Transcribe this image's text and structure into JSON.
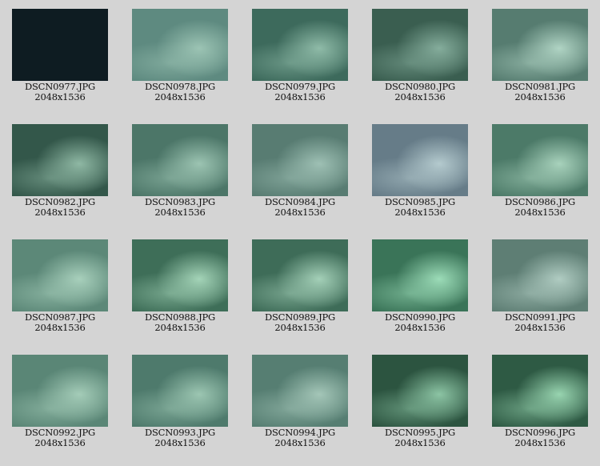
{
  "gallery": {
    "items": [
      {
        "name": "DSCN0977.JPG",
        "dims": "2048x1536",
        "base": "#0e1c22",
        "light": "#12242b"
      },
      {
        "name": "DSCN0978.JPG",
        "dims": "2048x1536",
        "base": "#5e8a80",
        "light": "#9cc4b4"
      },
      {
        "name": "DSCN0979.JPG",
        "dims": "2048x1536",
        "base": "#3d6a5c",
        "light": "#8fbba8"
      },
      {
        "name": "DSCN0980.JPG",
        "dims": "2048x1536",
        "base": "#3a5e50",
        "light": "#85ad9c"
      },
      {
        "name": "DSCN0981.JPG",
        "dims": "2048x1536",
        "base": "#567c70",
        "light": "#b0d4c4"
      },
      {
        "name": "DSCN0982.JPG",
        "dims": "2048x1536",
        "base": "#33574a",
        "light": "#8fb8a4"
      },
      {
        "name": "DSCN0983.JPG",
        "dims": "2048x1536",
        "base": "#4c7668",
        "light": "#9cc4b2"
      },
      {
        "name": "DSCN0984.JPG",
        "dims": "2048x1536",
        "base": "#587c72",
        "light": "#9ec0b4"
      },
      {
        "name": "DSCN0985.JPG",
        "dims": "2048x1536",
        "base": "#667c88",
        "light": "#b4cace"
      },
      {
        "name": "DSCN0986.JPG",
        "dims": "2048x1536",
        "base": "#4c7a68",
        "light": "#a8d2bc"
      },
      {
        "name": "DSCN0987.JPG",
        "dims": "2048x1536",
        "base": "#5c8878",
        "light": "#a8d0bc"
      },
      {
        "name": "DSCN0988.JPG",
        "dims": "2048x1536",
        "base": "#3e6e58",
        "light": "#a4d4b8"
      },
      {
        "name": "DSCN0989.JPG",
        "dims": "2048x1536",
        "base": "#3e6c58",
        "light": "#a4d0b8"
      },
      {
        "name": "DSCN0990.JPG",
        "dims": "2048x1536",
        "base": "#3a7458",
        "light": "#9cdcb8"
      },
      {
        "name": "DSCN0991.JPG",
        "dims": "2048x1536",
        "base": "#5e7e74",
        "light": "#b0ccc2"
      },
      {
        "name": "DSCN0992.JPG",
        "dims": "2048x1536",
        "base": "#5a8676",
        "light": "#a4ccb8"
      },
      {
        "name": "DSCN0993.JPG",
        "dims": "2048x1536",
        "base": "#4e7a6c",
        "light": "#9cc6b2"
      },
      {
        "name": "DSCN0994.JPG",
        "dims": "2048x1536",
        "base": "#567e72",
        "light": "#a4c6b8"
      },
      {
        "name": "DSCN0995.JPG",
        "dims": "2048x1536",
        "base": "#2c5440",
        "light": "#8cc4a4"
      },
      {
        "name": "DSCN0996.JPG",
        "dims": "2048x1536",
        "base": "#2e5a44",
        "light": "#98d4b0"
      }
    ]
  }
}
